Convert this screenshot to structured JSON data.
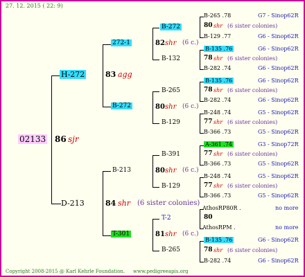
{
  "header_date": "27. 12. 2015 (  22:  9)",
  "root": {
    "id": "02133",
    "score": "86",
    "race": "sjr"
  },
  "gen1": {
    "top": {
      "label": "H-272",
      "score": "83",
      "race": "agg"
    },
    "bottom": {
      "label": "D-213",
      "score": "84",
      "race": "shr",
      "note": "(6 sister colonies)"
    }
  },
  "gen2": [
    {
      "label": "272-1",
      "score": "82",
      "race": "shr",
      "note": "(6 c.)"
    },
    {
      "label": "B-272",
      "score": "80",
      "race": "shr",
      "note": "(6 c.)"
    },
    {
      "label": "B-213",
      "score": "80",
      "race": "shr",
      "note": "(6 c.)"
    },
    {
      "label": "T-301",
      "score": "81",
      "race": "shr",
      "note": "(6 c.)"
    }
  ],
  "gen3": [
    "B-272",
    "B-132",
    "B-265",
    "B-129",
    "B-391",
    "B-129",
    "T-2",
    "B-265"
  ],
  "gen4": [
    {
      "top": "B-265 .78",
      "top_right": "G7 - Sinop62R",
      "mid_score": "80",
      "mid_race": "shr",
      "mid_note": "(6 sister colonies)",
      "bot": "B-129 .77",
      "bot_right": "G6 - Sinop62R"
    },
    {
      "top": "B-135 .76",
      "top_right": "G6 - Sinop62R",
      "mid_score": "78",
      "mid_race": "shr",
      "mid_note": "(6 sister colonies)",
      "bot": "B-282 .74",
      "bot_right": "G6 - Sinop62R"
    },
    {
      "top": "B-135 .76",
      "top_right": "G6 - Sinop62R",
      "mid_score": "78",
      "mid_race": "shr",
      "mid_note": "(6 sister colonies)",
      "bot": "B-282 .74",
      "bot_right": "G6 - Sinop62R"
    },
    {
      "top": "B-248 .74",
      "top_right": "G5 - Sinop62R",
      "mid_score": "77",
      "mid_race": "shr",
      "mid_note": "(6 sister colonies)",
      "bot": "B-366 .73",
      "bot_right": "G5 - Sinop62R"
    },
    {
      "top": "A-361 .74",
      "top_right": "G3 - Sinop72R",
      "mid_score": "77",
      "mid_race": "shr",
      "mid_note": "(6 sister colonies)",
      "bot": "B-366 .73",
      "bot_right": "G5 - Sinop62R"
    },
    {
      "top": "B-248 .74",
      "top_right": "G5 - Sinop62R",
      "mid_score": "77",
      "mid_race": "shr",
      "mid_note": "(6 sister colonies)",
      "bot": "B-366 .73",
      "bot_right": "G5 - Sinop62R"
    },
    {
      "top": "AthosRP80R .",
      "top_right": "no more",
      "mid_score": "80",
      "mid_race": "",
      "mid_note": "",
      "bot": "AthosRPM .",
      "bot_right": "no more"
    },
    {
      "top": "B-135 .76",
      "top_right": "G6 - Sinop62R",
      "mid_score": "78",
      "mid_race": "shr",
      "mid_note": "(6 sister colonies)",
      "bot": "B-282 .74",
      "bot_right": "G6 - Sinop62R"
    }
  ],
  "footer": {
    "copyright": "Copyright 2008-2015 @ Karl Kehrle Foundation.",
    "url": "www.pedigreeapis.org"
  },
  "colors": {
    "border": "#cc0099",
    "box_cyan": "#33ddff",
    "box_green": "#22dd22",
    "root_box": "#ffccff",
    "right_text": "#1a1ab0"
  }
}
